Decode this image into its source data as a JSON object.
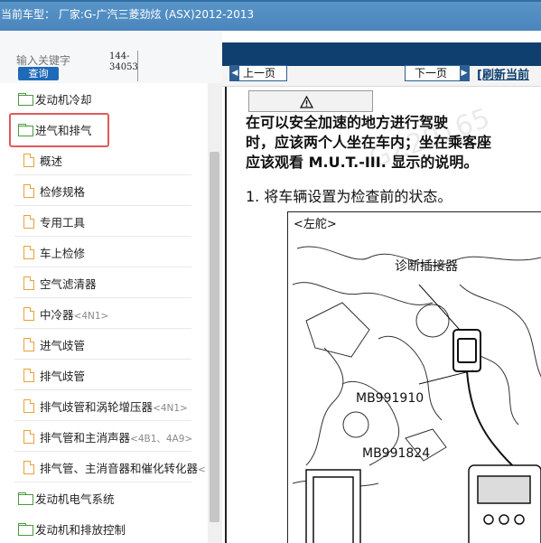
{
  "window": {
    "title": "当前车型： 厂家:G-广汽三菱劲炫 (ASX)2012-2013"
  },
  "search": {
    "placeholder": "输入关键字",
    "button_label": "查询",
    "code_text": "144-34053"
  },
  "tree": {
    "items": [
      {
        "type": "folder",
        "label": "发动机冷却",
        "tag": ""
      },
      {
        "type": "folder",
        "label": "进气和排气",
        "tag": "",
        "highlighted": true
      },
      {
        "type": "doc",
        "label": "概述",
        "tag": ""
      },
      {
        "type": "doc",
        "label": "检修规格",
        "tag": ""
      },
      {
        "type": "doc",
        "label": "专用工具",
        "tag": ""
      },
      {
        "type": "doc",
        "label": "车上检修",
        "tag": ""
      },
      {
        "type": "doc",
        "label": "空气滤清器",
        "tag": ""
      },
      {
        "type": "doc",
        "label": "中冷器",
        "tag": "<4N1>"
      },
      {
        "type": "doc",
        "label": "进气歧管",
        "tag": ""
      },
      {
        "type": "doc",
        "label": "排气歧管",
        "tag": ""
      },
      {
        "type": "doc",
        "label": "排气歧管和涡轮增压器",
        "tag": "<4N1>"
      },
      {
        "type": "doc",
        "label": "排气管和主消声器",
        "tag": "<4B1、4A9>"
      },
      {
        "type": "doc",
        "label": "排气管、主消音器和催化转化器",
        "tag": "<"
      },
      {
        "type": "folder",
        "label": "发动机电气系统",
        "tag": ""
      },
      {
        "type": "folder",
        "label": "发动机和排放控制",
        "tag": ""
      }
    ]
  },
  "nav": {
    "prev_label": "上一页",
    "next_label": "下一页",
    "refresh_label": "[刷新当前"
  },
  "document": {
    "warning_icon": "warning-triangle-icon",
    "paragraph_lines": [
      "在可以安全加速的地方进行驾驶",
      "时，应该两个人坐在车内；坐在乘客座",
      "应该观看 M.U.T.-III. 显示的说明。"
    ],
    "step_1": "1. 将车辆设置为检查前的状态。",
    "figure": {
      "side_label": "<左舵>",
      "connector_label": "诊断插接器",
      "part_1": "MB991910",
      "part_2": "MB991824"
    },
    "watermark": "GZ20165"
  },
  "colors": {
    "title_bar": "#4a86bd",
    "nav_dark": "#0e3f6e",
    "highlight": "#e05a5a",
    "folder": "#4a9a3a",
    "doc": "#e7a23b"
  }
}
